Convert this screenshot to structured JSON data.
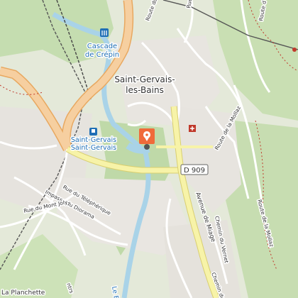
{
  "map": {
    "place_main_line1": "Saint-Gervais-",
    "place_main_line2": "les-Bains",
    "waterfall_line1": "Cascade",
    "waterfall_line2": "de Crépin",
    "station_line1": "Saint-Gervais",
    "station_line2": "Saint-Gervais",
    "road_badge": "D 909",
    "streets": {
      "rue_telepherique": "Rue du Téléphérique",
      "impasse_dioramas": "Impasse du Diorama",
      "rue_mont_joly": "Rue du Mont Joly",
      "avenue_miage": "Avenue de Miage",
      "chemin_vernet": "Chemin du Vernet",
      "route_mollaz": "Route de la Mollaz",
      "route_mollaz_2": "Route de la Mollaz",
      "chemin_du": "Chemin du",
      "route_du_bas": "Route du",
      "route_mont_lachat": "Route du Mont Lachat",
      "route_n": "Route d",
      "rue_ctr": "Rue",
      "ntrs": "ntrs"
    },
    "place_planchette": "La Planchette",
    "river_label": "Le Bo",
    "colors": {
      "forest": "#c8dfb4",
      "urban": "#e6e4df",
      "main_road": "#f6cfa0",
      "main_road_edge": "#e8a860",
      "secondary_road": "#f7f3a8",
      "water": "#a9d3e8",
      "marker": "#f06a3a"
    },
    "icons": [
      "waterfall-icon",
      "train-station-icon",
      "location-marker-icon",
      "hospital-icon",
      "poi-dot-icon"
    ]
  }
}
